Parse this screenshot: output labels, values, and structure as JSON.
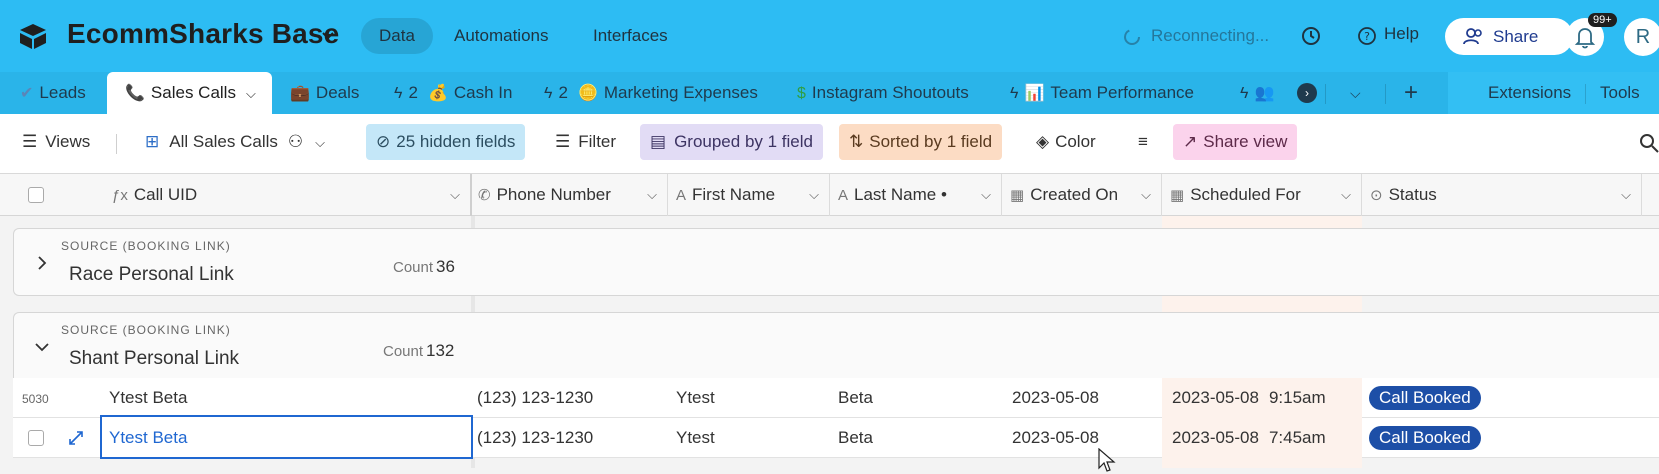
{
  "topbar": {
    "base_name": "EcommSharks Base",
    "nav": [
      "Data",
      "Automations",
      "Interfaces"
    ],
    "reconnecting": "Reconnecting...",
    "help": "Help",
    "share": "Share",
    "badge": "99+",
    "avatar": "R"
  },
  "tabs": {
    "items": [
      "Leads",
      "Sales Calls",
      "Deals",
      "2",
      "Cash In",
      "2",
      "Marketing Expenses",
      "Instagram Shoutouts",
      "Team Performance"
    ],
    "extensions": "Extensions",
    "tools": "Tools"
  },
  "toolbar": {
    "views": "Views",
    "view_name": "All Sales Calls",
    "hidden_fields": "25 hidden fields",
    "filter": "Filter",
    "grouped": "Grouped by 1 field",
    "sorted": "Sorted by 1 field",
    "color": "Color",
    "share_view": "Share view"
  },
  "columns": [
    "Call UID",
    "Phone Number",
    "First Name",
    "Last Name •",
    "Created On",
    "Scheduled For",
    "Status"
  ],
  "groups": [
    {
      "kicker": "SOURCE (BOOKING LINK)",
      "title": "Race Personal Link",
      "count_label": "Count",
      "count": "36"
    },
    {
      "kicker": "SOURCE (BOOKING LINK)",
      "title": "Shant Personal Link",
      "count_label": "Count",
      "count": "132"
    }
  ],
  "rows": [
    {
      "num": "5030",
      "uid": "Ytest Beta",
      "phone": "(123) 123-1230",
      "first": "Ytest",
      "last": "Beta",
      "created": "2023-05-08",
      "scheduled": "2023-05-08",
      "time": "9:15am",
      "status": "Call Booked"
    },
    {
      "num": "",
      "uid": "Ytest Beta",
      "phone": "(123) 123-1230",
      "first": "Ytest",
      "last": "Beta",
      "created": "2023-05-08",
      "scheduled": "2023-05-08",
      "time": "7:45am",
      "status": "Call Booked"
    }
  ],
  "colors": {
    "topbar": "#2dbcf3",
    "status_pill": "#1d4fa7",
    "selection": "#1f67d1"
  }
}
